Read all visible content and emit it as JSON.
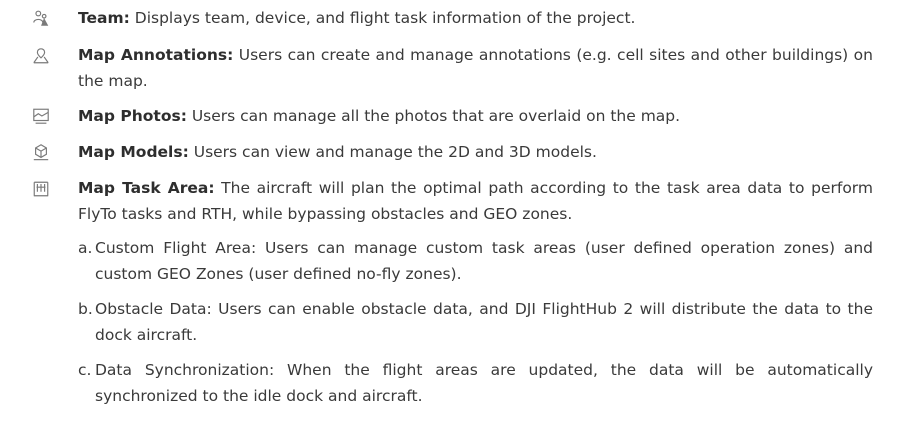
{
  "items": [
    {
      "icon": "team-icon",
      "term": "Team:",
      "text": " Displays team, device, and flight task information of the project."
    },
    {
      "icon": "map-annotation-icon",
      "term": "Map Annotations:",
      "text": " Users can create and manage annotations (e.g. cell sites and other buildings) on the map."
    },
    {
      "icon": "map-photo-icon",
      "term": "Map Photos:",
      "text": " Users can manage all the photos that are overlaid on the map."
    },
    {
      "icon": "map-model-icon",
      "term": "Map Models:",
      "text": " Users can view and manage the 2D and 3D models."
    },
    {
      "icon": "map-task-area-icon",
      "term": "Map Task Area:",
      "text": " The aircraft will plan the optimal path according to the task area data to perform FlyTo tasks and RTH, while bypassing obstacles and GEO zones."
    }
  ],
  "subitems": [
    {
      "letter": "a.",
      "text": "Custom Flight Area: Users can manage custom task areas (user defined operation zones) and custom GEO Zones (user defined no-fly zones)."
    },
    {
      "letter": "b.",
      "text": "Obstacle Data: Users can enable obstacle data, and DJI FlightHub 2 will distribute the data to the dock aircraft."
    },
    {
      "letter": "c.",
      "text": "Data Synchronization: When the flight areas are updated, the data will be automatically synchronized to the idle dock and aircraft."
    }
  ],
  "colors": {
    "text": "#3a3a3a",
    "icon": "#7a7a7a"
  }
}
